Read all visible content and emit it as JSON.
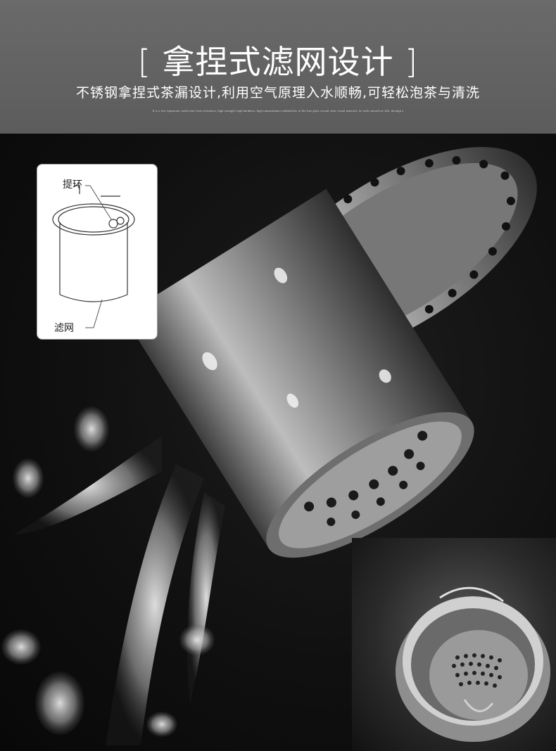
{
  "header": {
    "title": "[ 拿捏式滤网设计 ]",
    "subtitle": "不锈钢拿捏式茶漏设计,利用空气原理入水顺畅,可轻松泡茶与清洗",
    "fine_print": "It is a low expansion coefficient, heat resistance, high strength, high hardness, high transmittance andstability of the fine glass crystal clear visual material, its walls smooth as silk, through a"
  },
  "diagram": {
    "label_handle": "提环",
    "label_filter": "滤网"
  },
  "colors": {
    "header_bg": "#5f5f5f",
    "photo_bg": "#0d0d0d",
    "steel": "#b8b8b8"
  }
}
